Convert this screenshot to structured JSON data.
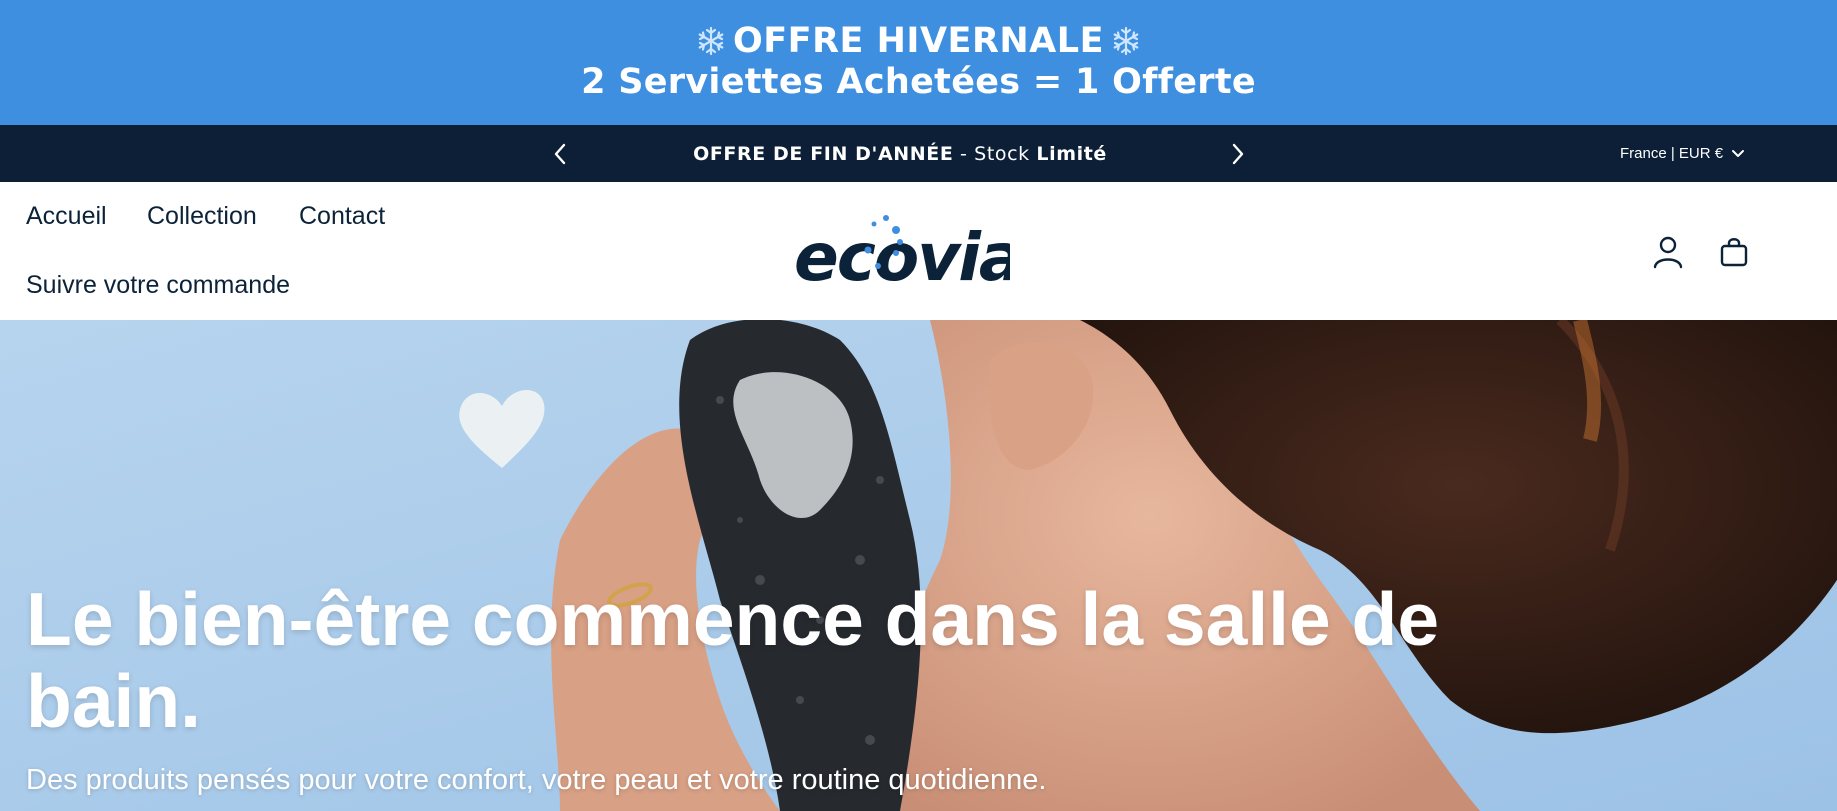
{
  "promo": {
    "line1": "OFFRE HIVERNALE",
    "line2": "2 Serviettes Achetées = 1 Offerte",
    "icon": "snowflake-icon",
    "background": "#3e8fe0"
  },
  "announcement": {
    "bold_text": "OFFRE DE FIN D'ANNÉE",
    "separator": " - ",
    "normal_text": "Stock ",
    "bold_suffix": "Limité",
    "background": "#0c1f36"
  },
  "locale": {
    "label": "France | EUR €"
  },
  "nav": {
    "home": "Accueil",
    "collection": "Collection",
    "contact": "Contact",
    "track_order": "Suivre votre commande"
  },
  "logo": {
    "text": "ecovia",
    "color": "#0b2238",
    "accent": "#3e8fe0"
  },
  "hero": {
    "title": "Le bien-être commence dans la salle de bain.",
    "subtitle": "Des produits pensés pour votre confort, votre peau et votre routine quotidienne."
  }
}
